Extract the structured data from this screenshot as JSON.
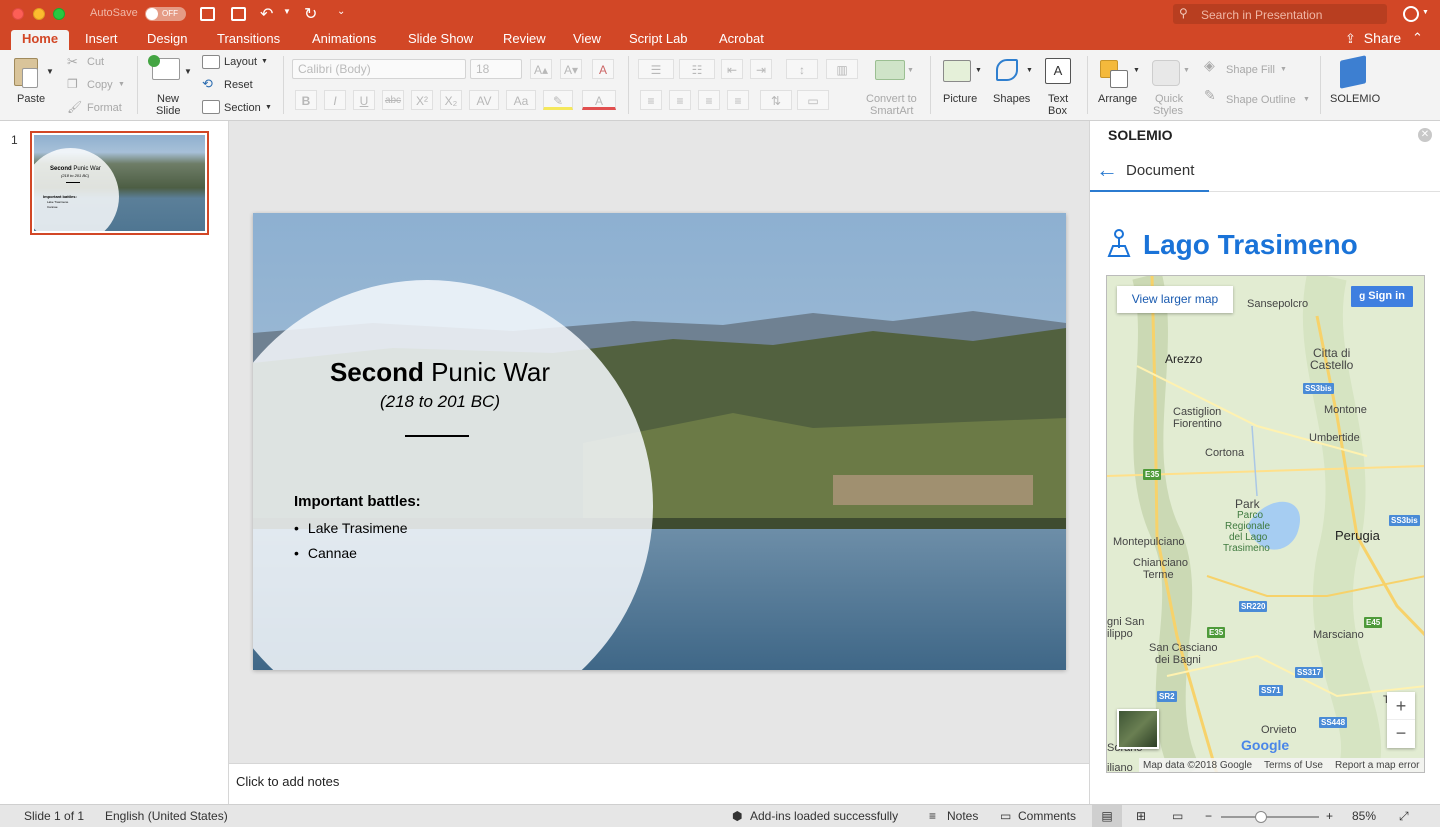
{
  "window": {
    "autosave_label": "AutoSave",
    "autosave_state": "OFF",
    "search_placeholder": "Search in Presentation"
  },
  "tabs": [
    "Home",
    "Insert",
    "Design",
    "Transitions",
    "Animations",
    "Slide Show",
    "Review",
    "View",
    "Script Lab",
    "Acrobat"
  ],
  "share_label": "Share",
  "ribbon": {
    "paste": "Paste",
    "cut": "Cut",
    "copy": "Copy",
    "format": "Format",
    "new_slide_1": "New",
    "new_slide_2": "Slide",
    "layout": "Layout",
    "reset": "Reset",
    "section": "Section",
    "font_name": "Calibri (Body)",
    "font_size": "18",
    "convert_1": "Convert to",
    "convert_2": "SmartArt",
    "picture": "Picture",
    "shapes": "Shapes",
    "textbox_1": "Text",
    "textbox_2": "Box",
    "arrange": "Arrange",
    "quick_1": "Quick",
    "quick_2": "Styles",
    "shape_fill": "Shape Fill",
    "shape_outline": "Shape Outline",
    "solemio": "SOLEMIO"
  },
  "thumb": {
    "number": "1",
    "title_bold": "Second",
    "title_rest": " Punic War",
    "subtitle": "(218 to 201 BC)",
    "heading": "Important battles:",
    "items": [
      "Lake Trasimene",
      "Cannae"
    ]
  },
  "slide": {
    "title_bold": "Second",
    "title_rest": " Punic War",
    "subtitle": "(218 to 201 BC)",
    "heading": "Important battles:",
    "items": [
      "Lake Trasimene",
      "Cannae"
    ]
  },
  "notes_placeholder": "Click to add notes",
  "addin": {
    "header": "SOLEMIO",
    "back_label": "Document",
    "place_title": "Lago Trasimeno",
    "map": {
      "view_larger": "View larger map",
      "sign_in": "Sign in",
      "labels": {
        "sansepolcro": "Sansepolcro",
        "arezzo": "Arezzo",
        "citta1": "Citta di",
        "citta2": "Castello",
        "castiglion1": "Castiglion",
        "castiglion2": "Fiorentino",
        "montone": "Montone",
        "umbertide": "Umbertide",
        "cortona": "Cortona",
        "park1": "Park",
        "park2": "Parco",
        "park3": "Regionale",
        "park4": "del Lago",
        "park5": "Trasimeno",
        "montepulciano": "Montepulciano",
        "perugia": "Perugia",
        "chianciano1": "Chianciano",
        "chianciano2": "Terme",
        "filippo1": "gni San",
        "filippo2": "ilippo",
        "sancasciano1": "San Casciano",
        "sancasciano2": "dei Bagni",
        "marsciano": "Marsciano",
        "todi": "Tod",
        "orvieto": "Orvieto",
        "sorano": "Sorano",
        "iliano": "iliano"
      },
      "shields": {
        "ss3bis_1": "SS3bis",
        "e35_1": "E35",
        "ss3bis_2": "SS3bis",
        "sr220": "SR220",
        "e35_2": "E35",
        "e45": "E45",
        "ss317": "SS317",
        "ss71": "SS71",
        "sr2": "SR2",
        "ss448": "SS448"
      },
      "zoom_in": "+",
      "zoom_out": "−",
      "google": "Google",
      "map_data": "Map data ©2018 Google",
      "terms": "Terms of Use",
      "report": "Report a map error"
    }
  },
  "status": {
    "slide_of": "Slide 1 of 1",
    "language": "English (United States)",
    "addins": "Add-ins loaded successfully",
    "notes": "Notes",
    "comments": "Comments",
    "zoom": "85%",
    "zoom_fraction": 0.4
  }
}
